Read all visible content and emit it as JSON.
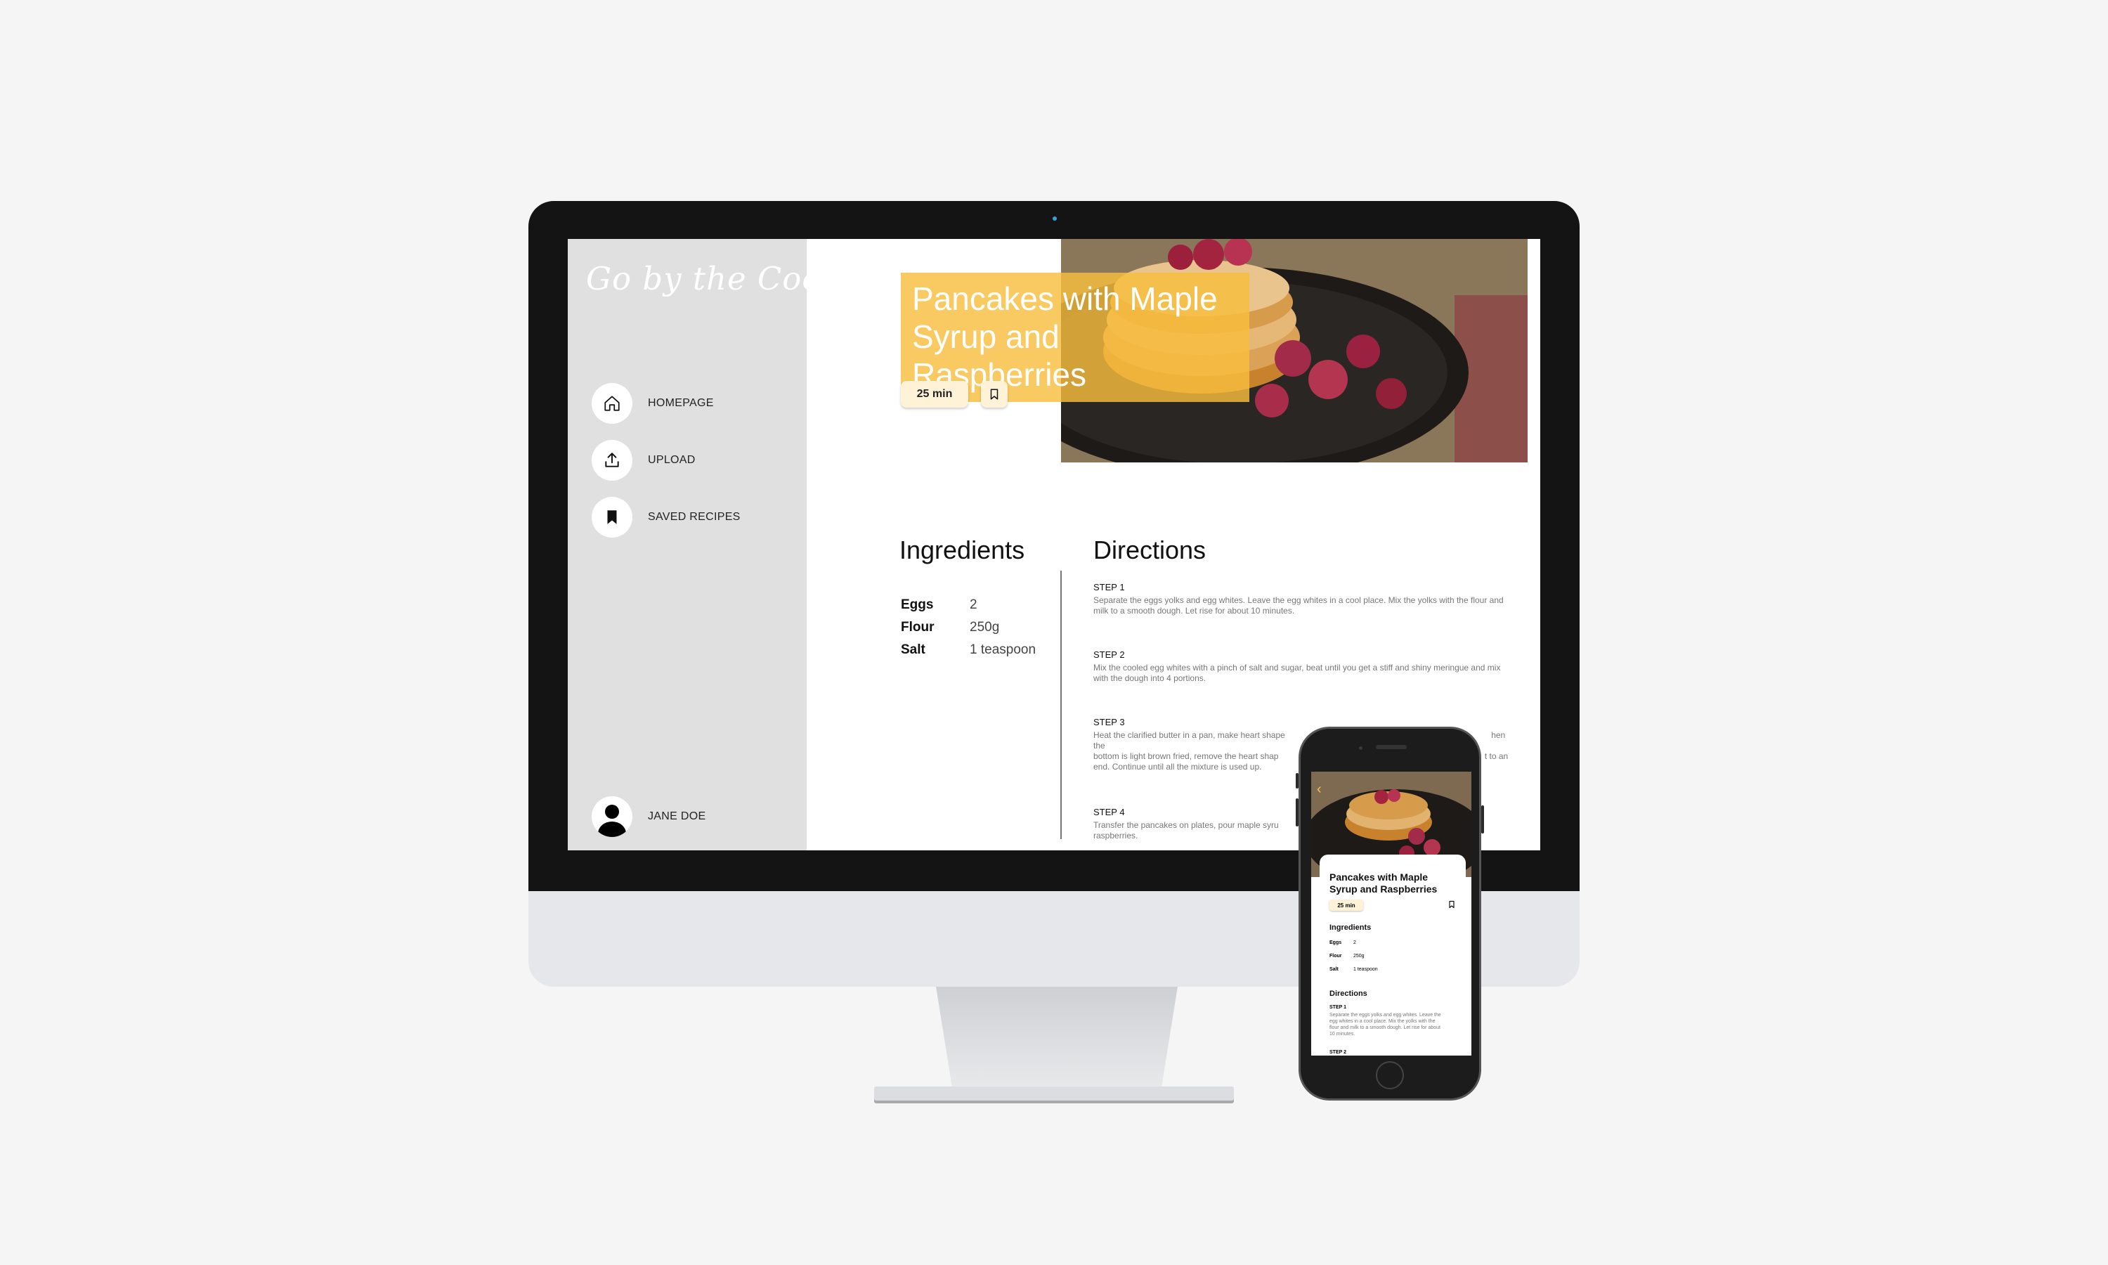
{
  "app": {
    "logo": "Go by the Cook"
  },
  "sidebar": {
    "items": [
      {
        "label": "HOMEPAGE",
        "icon": "home-icon"
      },
      {
        "label": "UPLOAD",
        "icon": "upload-icon"
      },
      {
        "label": "SAVED RECIPES",
        "icon": "bookmark-icon"
      }
    ],
    "user": {
      "name": "JANE DOE",
      "icon": "user-icon"
    }
  },
  "recipe": {
    "title": "Pancakes with Maple Syrup and Raspberries",
    "time": "25 min",
    "ingredients_heading": "Ingredients",
    "directions_heading": "Directions",
    "ingredients": [
      {
        "name": "Eggs",
        "qty": "2"
      },
      {
        "name": "Flour",
        "qty": "250g"
      },
      {
        "name": "Salt",
        "qty": "1 teaspoon"
      }
    ],
    "steps": [
      {
        "label": "STEP 1",
        "text": "Separate the eggs yolks and egg whites. Leave the egg whites in a cool place. Mix the yolks with the flour and milk to a smooth dough. Let rise for about 10 minutes."
      },
      {
        "label": "STEP 2",
        "text": "Mix the cooled egg whites with a pinch of salt and sugar, beat until you get a stiff and shiny meringue and mix with the dough into 4 portions."
      },
      {
        "label": "STEP 3",
        "text": "Heat the clarified butter in a pan, make heart shape"
      },
      {
        "label": "STEP 4",
        "text": "Transfer the pancakes on plates, pour maple syru"
      }
    ],
    "step3_line1_tail": "hen the",
    "step3_line2": "bottom is light brown fried, remove the heart shap",
    "step3_line2_tail": "t to an",
    "step3_line3": "end. Continue until all the mixture is used up.",
    "step4_line2": "raspberries."
  },
  "phone": {
    "title": "Pancakes with Maple Syrup and Raspberries",
    "time": "25 min",
    "ingredients_heading": "Ingredients",
    "directions_heading": "Directions",
    "step1_label": "STEP 1",
    "step1_text": "Separate the eggs yolks and egg whites. Leave the egg whites in a cool place. Mix the yolks with the flour and milk to a smooth dough. Let rise for about 10 minutes.",
    "step2_label": "STEP 2"
  },
  "colors": {
    "accent": "#f8be3e",
    "badge": "#fff2d6",
    "sidebar": "#e0e0e0"
  }
}
